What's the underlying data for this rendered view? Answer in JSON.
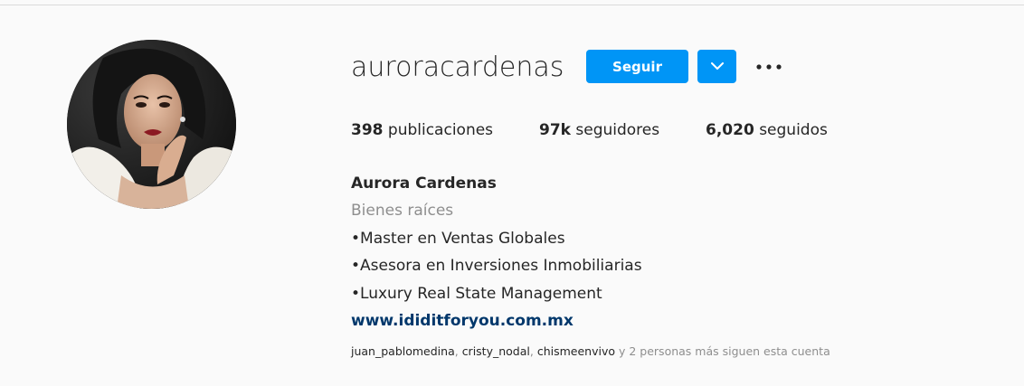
{
  "profile": {
    "username": "auroracardenas",
    "follow_label": "Seguir"
  },
  "stats": {
    "posts_count": "398",
    "posts_label": "publicaciones",
    "followers_count": "97k",
    "followers_label": "seguidores",
    "following_count": "6,020",
    "following_label": "seguidos"
  },
  "bio": {
    "full_name": "Aurora Cardenas",
    "category": "Bienes raíces",
    "lines": [
      "•Master en Ventas Globales",
      "•Asesora en Inversiones Inmobiliarias",
      "•Luxury Real State Management"
    ],
    "website": "www.ididitforyou.com.mx"
  },
  "followed_by": {
    "accounts": [
      "juan_pablomedina",
      "cristy_nodal",
      "chismeenvivo"
    ],
    "separator": ", ",
    "suffix": " y 2 personas más siguen esta cuenta"
  },
  "icons": {
    "dropdown": "chevron-down-icon",
    "more": "more-options-icon"
  },
  "colors": {
    "accent": "#0095f6",
    "link": "#00376b",
    "muted": "#8e8e8e",
    "text": "#262626",
    "background": "#fafafa"
  }
}
